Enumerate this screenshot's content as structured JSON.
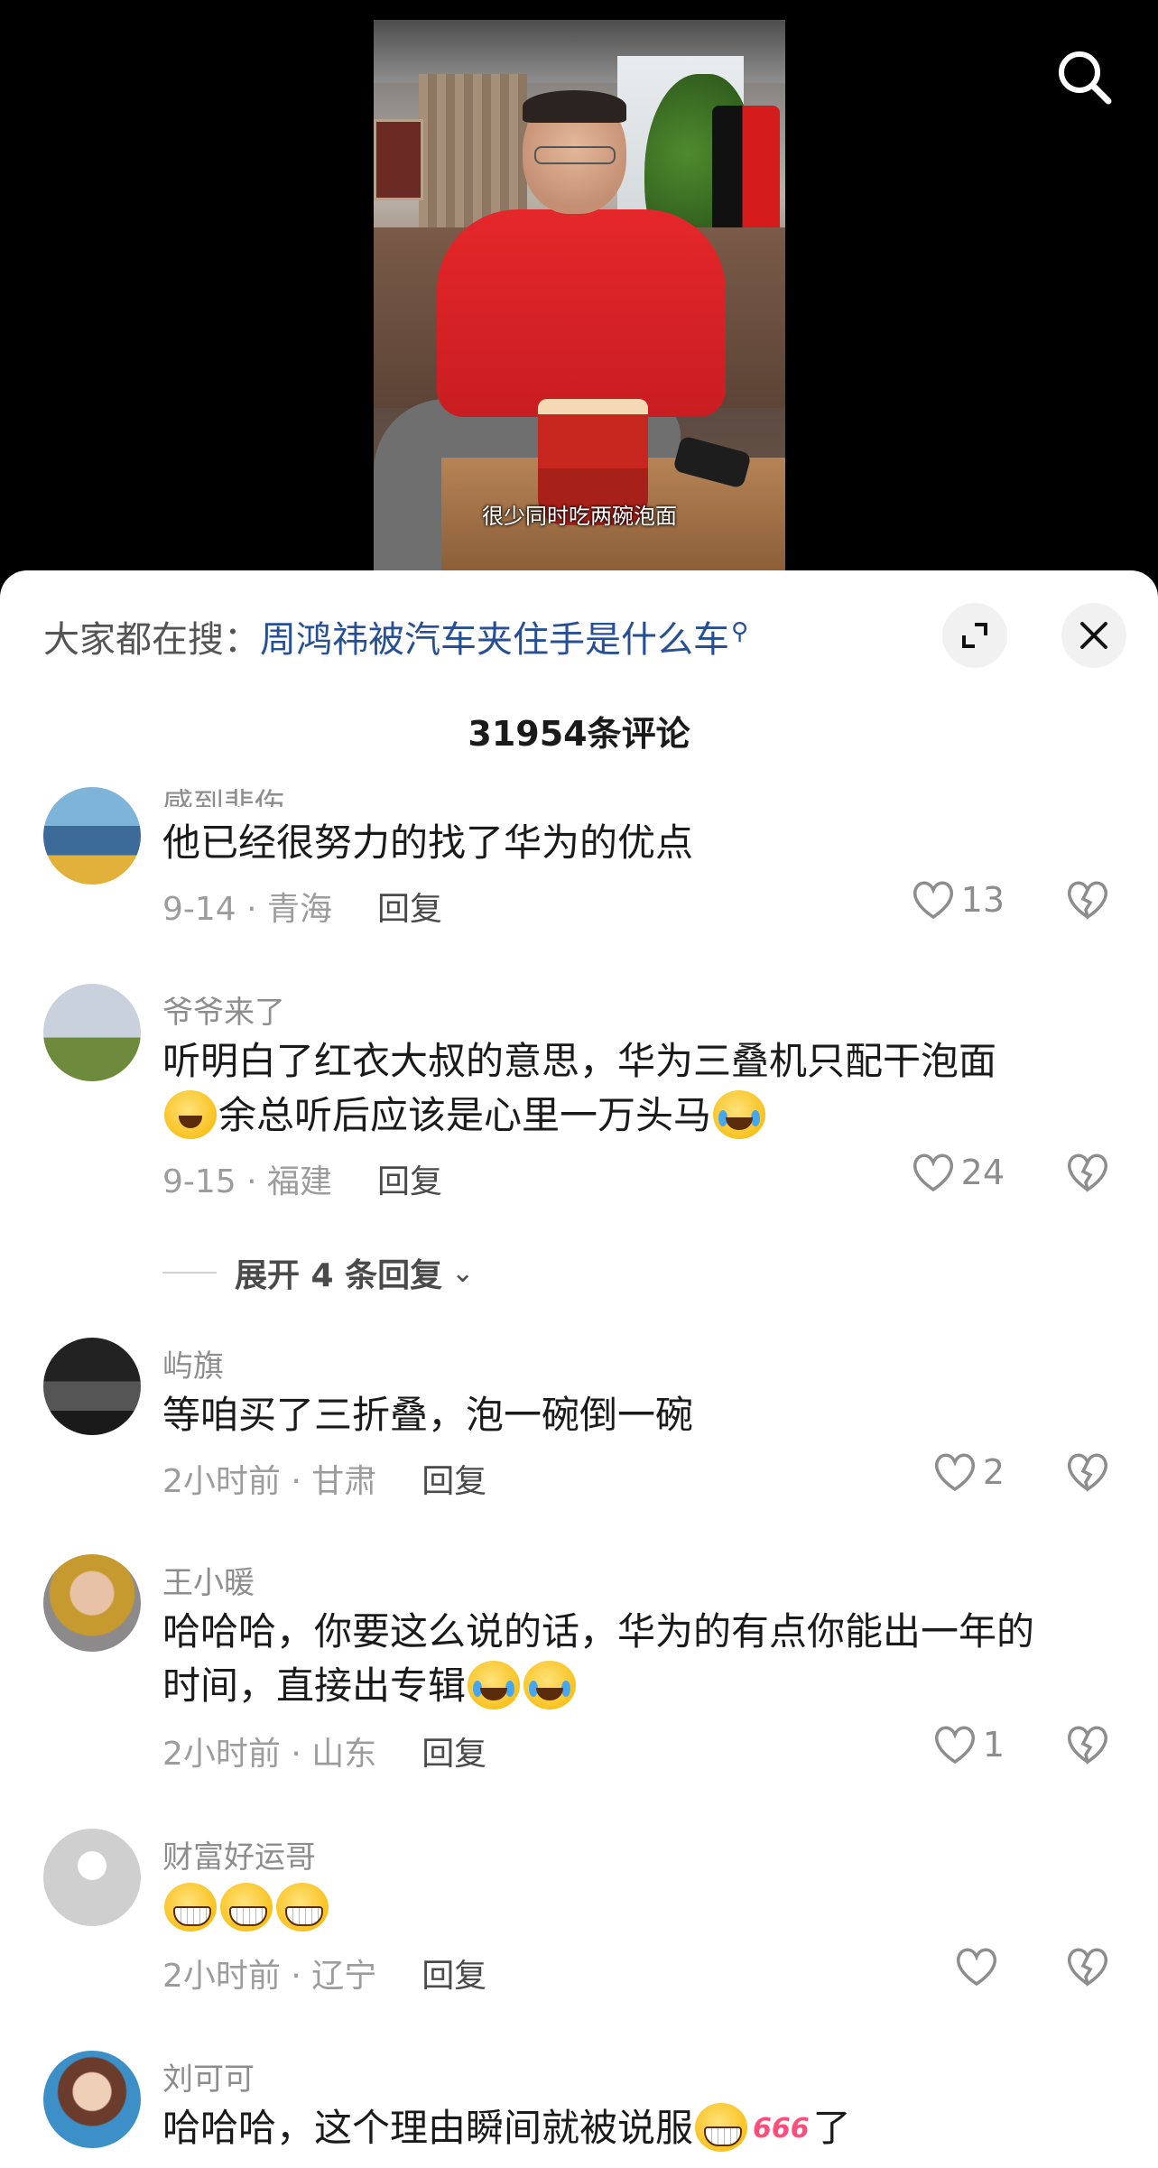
{
  "video": {
    "subtitle": "很少同时吃两碗泡面"
  },
  "top": {
    "search_icon": "search-icon"
  },
  "search_bar": {
    "prefix": "大家都在搜：",
    "query": "周鸿祎被汽车夹住手是什么车",
    "query_icon": "search-icon",
    "expand_icon": "expand-icon",
    "close_icon": "close-icon"
  },
  "comments_header": {
    "count_label": "31954条评论"
  },
  "comments": [
    {
      "username": "感到悲伤",
      "text": "他已经很努力的找了华为的优点",
      "date_loc": "9-14 · 青海",
      "reply": "回复",
      "likes": "13"
    },
    {
      "username": "爷爷来了",
      "text_line1": "听明白了红衣大叔的意思，华为三叠机只配干泡面",
      "text_line2": "余总听后应该是心里一万头马",
      "date_loc": "9-15 · 福建",
      "reply": "回复",
      "likes": "24",
      "expand_label": "展开 4 条回复"
    },
    {
      "username": "屿旗",
      "text": "等咱买了三折叠，泡一碗倒一碗",
      "date_loc": "2小时前 · 甘肃",
      "reply": "回复",
      "likes": "2"
    },
    {
      "username": "王小暖",
      "text_line1": "哈哈哈，你要这么说的话，华为的有点你能出一年的",
      "text_line2": "时间，直接出专辑",
      "date_loc": "2小时前 · 山东",
      "reply": "回复",
      "likes": "1"
    },
    {
      "username": "财富好运哥",
      "text": "",
      "date_loc": "2小时前 · 辽宁",
      "reply": "回复",
      "likes": ""
    },
    {
      "username": "刘可可",
      "text_before": "哈哈哈，这个理由瞬间就被说服",
      "badge": "666",
      "text_after": "了"
    }
  ],
  "colors": {
    "link_blue": "#264f94",
    "meta_gray": "#9c9c9c",
    "text": "#1a1a1a"
  }
}
